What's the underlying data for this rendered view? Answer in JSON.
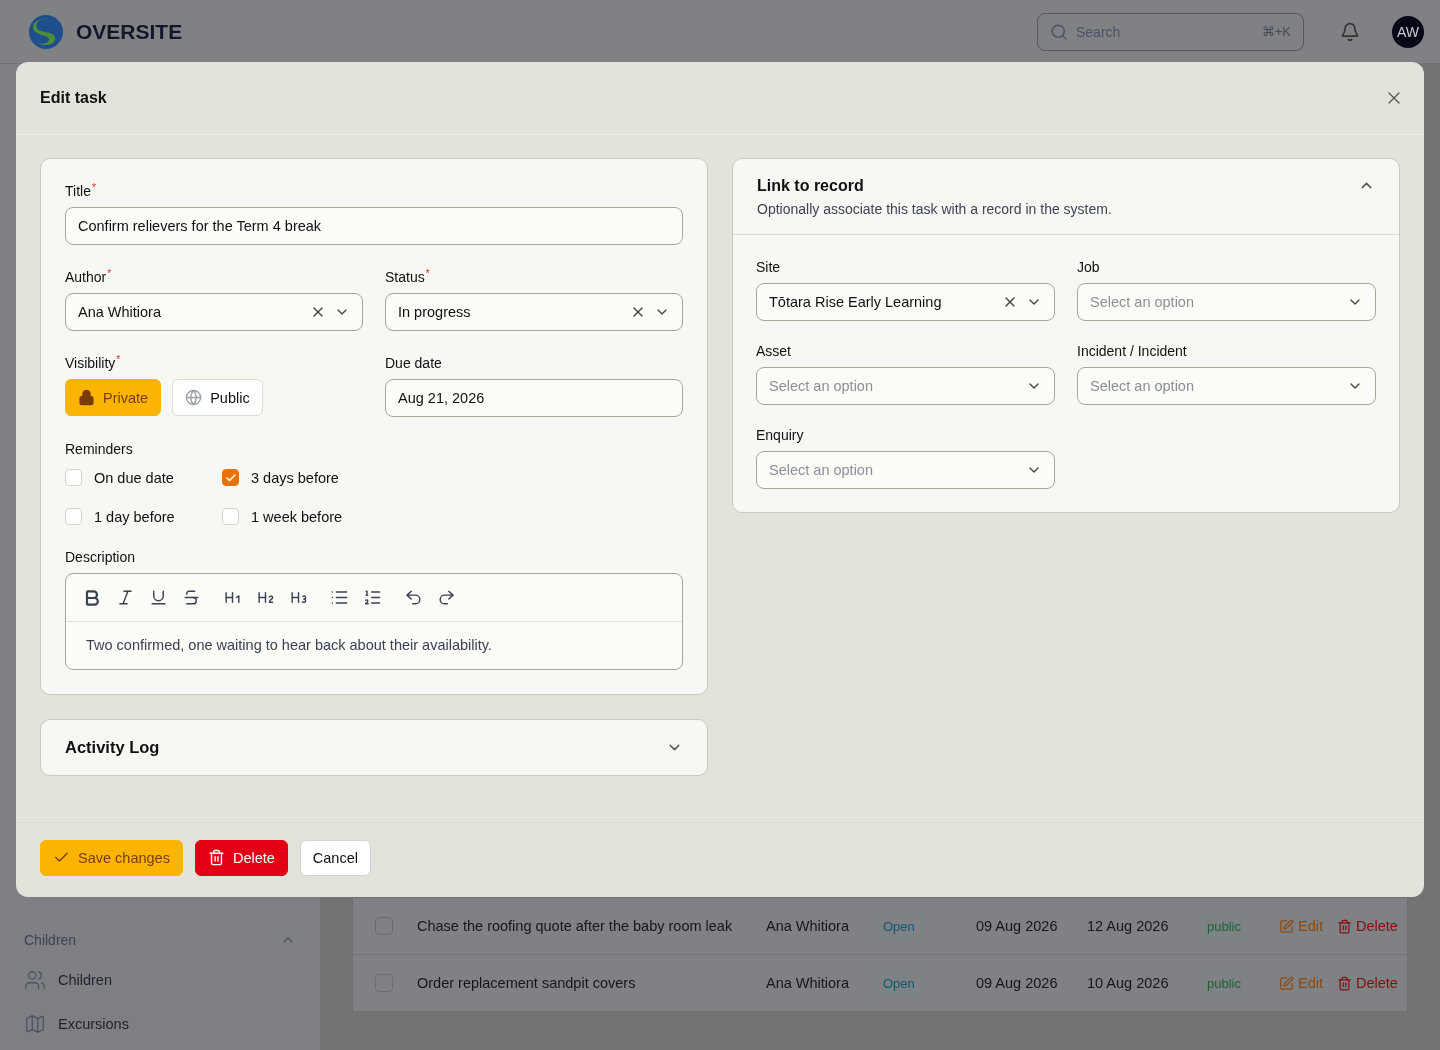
{
  "app": {
    "brand": "OVERSITE",
    "search": {
      "placeholder": "Search",
      "shortcut": "⌘+K"
    },
    "avatar": "AW"
  },
  "sidebar": {
    "section": "Children",
    "items": [
      {
        "label": "Children"
      },
      {
        "label": "Excursions"
      }
    ]
  },
  "table": {
    "rows": [
      {
        "checked": false,
        "title": "Chase the roofing quote after the baby room leak",
        "author": "Ana Whitiora",
        "status": "Open",
        "created": "09 Aug 2026",
        "due": "12 Aug 2026",
        "visibility": "public",
        "edit": "Edit",
        "delete": "Delete"
      },
      {
        "checked": false,
        "title": "Order replacement sandpit covers",
        "author": "Ana Whitiora",
        "status": "Open",
        "created": "09 Aug 2026",
        "due": "10 Aug 2026",
        "visibility": "public",
        "edit": "Edit",
        "delete": "Delete"
      }
    ]
  },
  "modal": {
    "title": "Edit task",
    "form": {
      "title": {
        "label": "Title",
        "required_mark": "*",
        "value": "Confirm relievers for the Term 4 break"
      },
      "author": {
        "label": "Author",
        "required_mark": "*",
        "value": "Ana Whitiora"
      },
      "status": {
        "label": "Status",
        "required_mark": "*",
        "value": "In progress"
      },
      "visibility": {
        "label": "Visibility",
        "required_mark": "*",
        "options": [
          {
            "label": "Private",
            "selected": true
          },
          {
            "label": "Public",
            "selected": false
          }
        ]
      },
      "due_date": {
        "label": "Due date",
        "value": "Aug 21, 2026"
      },
      "reminders": {
        "label": "Reminders",
        "options": [
          {
            "label": "On due date",
            "checked": false
          },
          {
            "label": "3 days before",
            "checked": true
          },
          {
            "label": "1 day before",
            "checked": false
          },
          {
            "label": "1 week before",
            "checked": false
          }
        ]
      },
      "description": {
        "label": "Description",
        "value": "Two confirmed, one waiting to hear back about their availability."
      }
    },
    "activity_log": {
      "title": "Activity Log",
      "expanded": false
    },
    "link": {
      "title": "Link to record",
      "subtitle": "Optionally associate this task with a record in the system.",
      "expanded": true,
      "fields": [
        {
          "label": "Site",
          "value": "Tōtara Rise Early Learning"
        },
        {
          "label": "Job",
          "placeholder": "Select an option"
        },
        {
          "label": "Asset",
          "placeholder": "Select an option"
        },
        {
          "label": "Incident / Incident",
          "placeholder": "Select an option"
        },
        {
          "label": "Enquiry",
          "placeholder": "Select an option"
        }
      ]
    },
    "buttons": [
      {
        "label": "Save changes",
        "kind": "save"
      },
      {
        "label": "Delete",
        "kind": "delete"
      },
      {
        "label": "Cancel",
        "kind": "cancel"
      }
    ]
  }
}
